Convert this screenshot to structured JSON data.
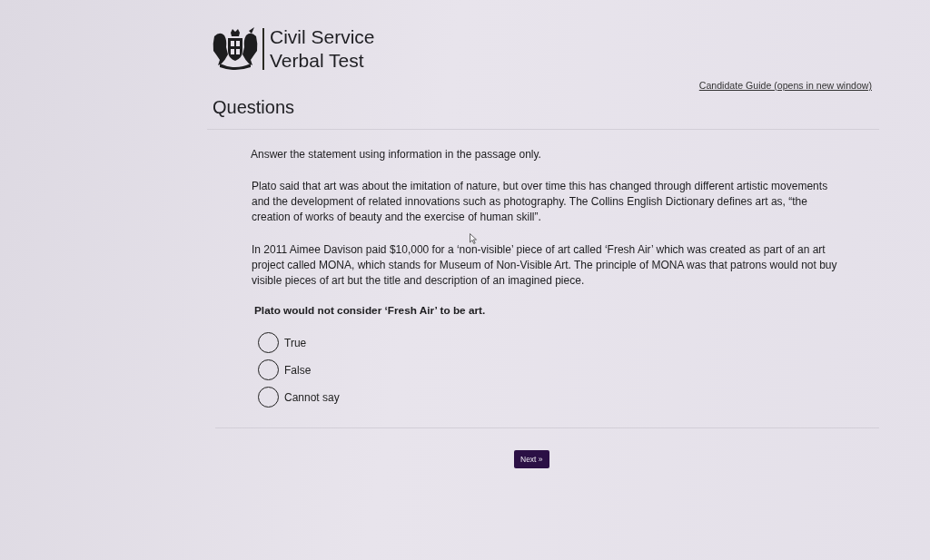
{
  "header": {
    "title_lines": [
      "Civil Service",
      "Verbal Test"
    ],
    "guide_link": "Candidate Guide (opens in new window)"
  },
  "heading": "Questions",
  "instruction": "Answer the statement using information in the passage only.",
  "passage": [
    "Plato said that art was about the imitation of nature, but over time this has changed through different artistic movements and the development of related innovations such as photography. The Collins English Dictionary defines art as, “the creation of works of beauty and the exercise of human skill”.",
    "In 2011 Aimee Davison paid $10,000 for a ‘non-visible’ piece of art called ‘Fresh Air’ which was created as part of an art project called MONA, which stands for Museum of Non-Visible Art. The principle of MONA was that patrons would not buy visible pieces of art but the title and description of an imagined piece."
  ],
  "statement": "Plato would not consider ‘Fresh Air’ to be art.",
  "options": [
    {
      "label": "True",
      "selected": false
    },
    {
      "label": "False",
      "selected": false
    },
    {
      "label": "Cannot say",
      "selected": false
    }
  ],
  "next_button": "Next »"
}
